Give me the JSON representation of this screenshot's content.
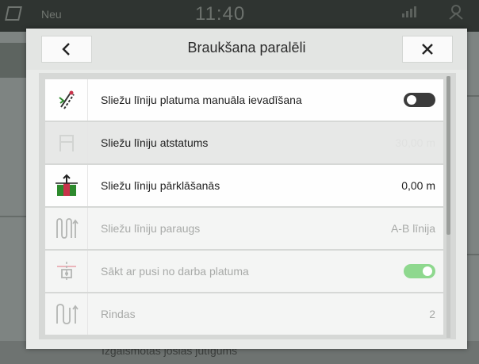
{
  "status_bar": {
    "mode": "Neu",
    "clock": "11:40"
  },
  "dialog": {
    "title": "Braukšana paralēli",
    "back_icon": "chevron-left-icon",
    "close_icon": "close-icon",
    "rows": [
      {
        "label": "Sliežu līniju platuma manuāla ievadīšana",
        "icon": "manual-width-icon",
        "control": "toggle",
        "toggle_on": false,
        "disabled": false
      },
      {
        "label": "Sliežu līniju atstatums",
        "value": "30,00 m",
        "icon": "track-spacing-icon",
        "disabled": false,
        "highlighted": true
      },
      {
        "label": "Sliežu līniju pārklāšanās",
        "value": "0,00 m",
        "icon": "track-overlap-icon",
        "disabled": false
      },
      {
        "label": "Sliežu līniju paraugs",
        "value": "A-B līnija",
        "icon": "track-pattern-icon",
        "disabled": true
      },
      {
        "label": "Sākt ar pusi no darba platuma",
        "icon": "half-width-icon",
        "control": "toggle",
        "toggle_on": true,
        "disabled": true
      },
      {
        "label": "Rindas",
        "value": "2",
        "icon": "rows-icon",
        "disabled": true
      }
    ]
  },
  "background": {
    "bottom_hint": "Izgaismotās joslas jutīgums"
  },
  "colors": {
    "toggle_on": "#8ed88e",
    "toggle_off": "#3b3b3b",
    "overlap_icon_green": "#2d8a2d",
    "overlap_icon_red": "#c8324a"
  }
}
